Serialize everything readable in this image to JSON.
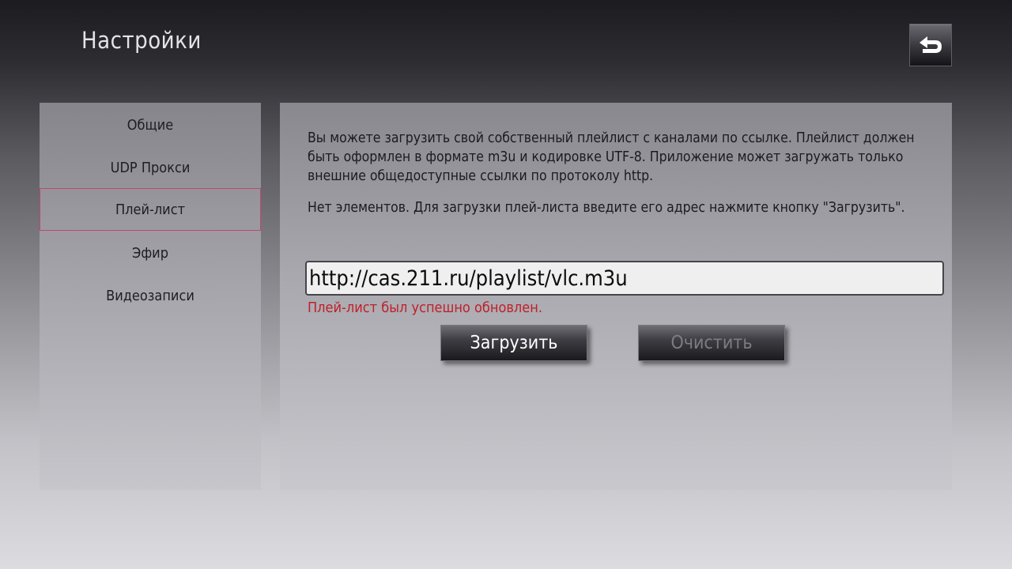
{
  "header": {
    "title": "Настройки",
    "back_icon": "undo-arrow-icon"
  },
  "sidebar": {
    "items": [
      {
        "label": "Общие"
      },
      {
        "label": "UDP Прокси"
      },
      {
        "label": "Плей-лист",
        "active": true
      },
      {
        "label": "Эфир"
      },
      {
        "label": "Видеозаписи"
      }
    ],
    "active_border_color": "#c4476a"
  },
  "main": {
    "description": "Вы можете загрузить свой собственный плейлист с каналами по ссылке. Плейлист должен быть оформлен в формате m3u и кодировке UTF-8. Приложение может загружать только внешние общедоступные ссылки по протоколу http.",
    "status": "Нет элементов. Для загрузки плей-листа введите его адрес нажмите кнопку \"Загрузить\".",
    "url_value": "http://cas.211.ru/playlist/vlc.m3u",
    "success_message": "Плей-лист был успешно обновлен.",
    "success_color": "#c0202a",
    "load_button": "Загрузить",
    "clear_button": "Очистить"
  }
}
